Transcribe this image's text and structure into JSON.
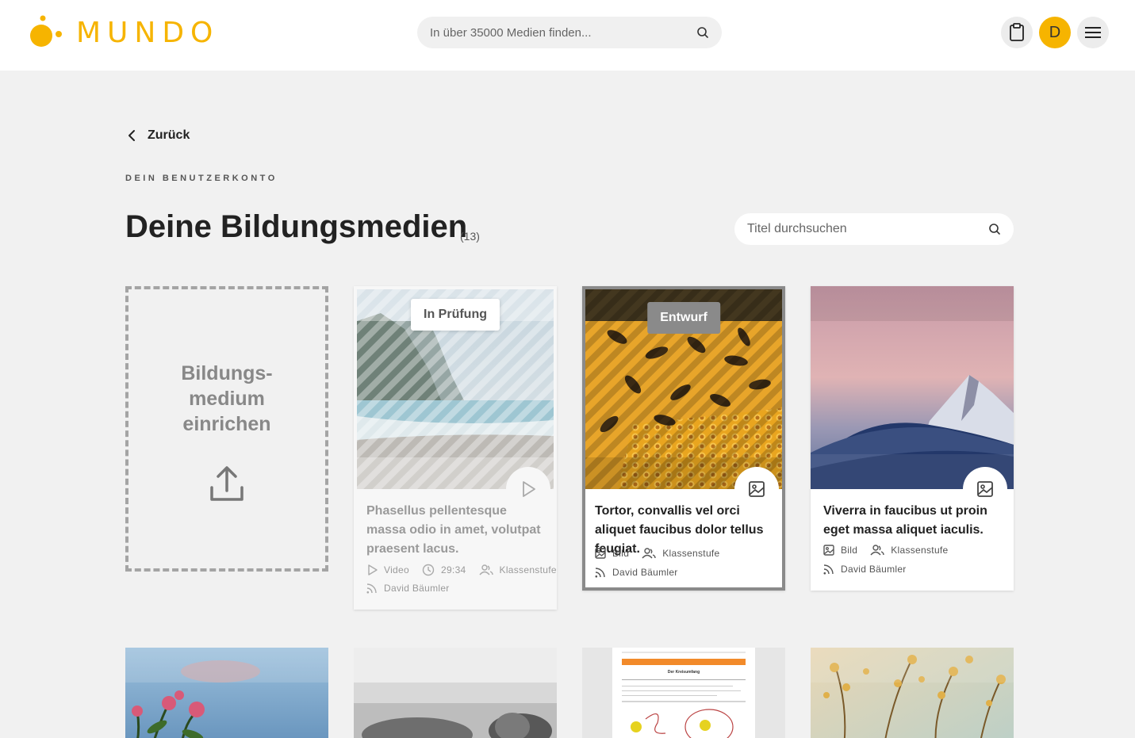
{
  "brand": {
    "name": "MUNDO",
    "color": "#f6b400"
  },
  "header": {
    "search_placeholder": "In über 35000 Medien finden...",
    "avatar_initial": "D"
  },
  "nav": {
    "back_label": "Zurück"
  },
  "page": {
    "eyebrow": "DEIN BENUTZERKONTO",
    "title": "Deine Bildungsmedien",
    "count": "(13)",
    "search_placeholder": "Titel durchsuchen"
  },
  "upload": {
    "label": "Bildungs-\nmedium\neinrichen"
  },
  "cards": [
    {
      "badge": "In Prüfung",
      "title": "Phasellus pellentesque massa odio in amet, volutpat praesent lacus.",
      "type": "Video",
      "type_icon": "play-icon",
      "duration": "29:34",
      "audience": "Klassenstufe",
      "author": "David Bäumler"
    },
    {
      "badge": "Entwurf",
      "title": "Tortor, convallis vel orci aliquet faucibus dolor tellus feugiat.",
      "type": "Bild",
      "type_icon": "image-icon",
      "audience": "Klassenstufe",
      "author": "David Bäumler"
    },
    {
      "title": "Viverra in faucibus ut proin eget massa aliquet iaculis.",
      "type": "Bild",
      "type_icon": "image-icon",
      "audience": "Klassenstufe",
      "author": "David Bäumler"
    }
  ],
  "worksheet": {
    "title": "Der Kreisumfang"
  }
}
